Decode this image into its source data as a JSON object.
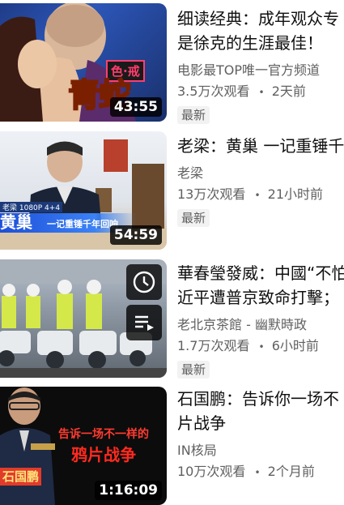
{
  "videos": [
    {
      "title_line1": "细读经典：成年观众专",
      "title_line2": "是徐克的生涯最佳！",
      "channel": "电影最TOP唯一官方频道",
      "views": "3.5万次观看",
      "age": "2天前",
      "badge": "最新",
      "duration": "43:55",
      "thumb_text_main": "青蛇",
      "thumb_text_tag": "色·戒"
    },
    {
      "title_line1": "老梁：黄巢 一记重锤千",
      "channel": "老梁",
      "views": "13万次观看",
      "age": "21小时前",
      "badge": "最新",
      "duration": "54:59",
      "thumb_text_main": "黄巢",
      "thumb_text_sub": "一记重锤千年回响",
      "thumb_text_top": "老梁 1080P 4+4"
    },
    {
      "title_line1": "華春瑩發威：中國“不怕",
      "title_line2": "近平遭普京致命打擊；",
      "channel": "老北京茶館 - 幽默時政",
      "views": "1.7万次观看",
      "age": "6小时前",
      "badge": "最新"
    },
    {
      "title_line1": "石国鹏：告诉你一场不",
      "title_line2": "片战争",
      "channel": "IN核局",
      "views": "10万次观看",
      "age": "2个月前",
      "duration": "1:16:09",
      "thumb_text_line1": "告诉一场不一样的",
      "thumb_text_line2": "鸦片战争",
      "thumb_text_name": "石国鹏"
    }
  ],
  "separator": "•",
  "colors": {
    "title": "#0f0f0f",
    "meta": "#606060",
    "badge_bg": "#f2f2f2"
  }
}
